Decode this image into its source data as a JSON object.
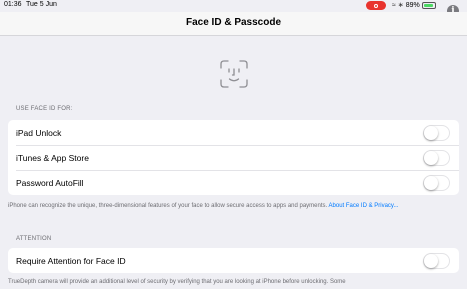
{
  "status_bar": {
    "time": "01:36",
    "date": "Tue 5 Jun",
    "wifi_icon": "wifi-icon",
    "bluetooth_icon": "bluetooth-icon",
    "battery_percent": "89%",
    "battery_level": 0.89,
    "recording_color": "#e8332e"
  },
  "nav": {
    "title": "Face ID & Passcode"
  },
  "header_icon": "face-id-icon",
  "use_face_id": {
    "header": "USE FACE ID FOR:",
    "rows": [
      {
        "label": "iPad Unlock",
        "on": false
      },
      {
        "label": "iTunes & App Store",
        "on": false
      },
      {
        "label": "Password AutoFill",
        "on": false
      }
    ],
    "footer": "iPhone can recognize the unique, three-dimensional features of your face to allow secure access to apps and payments.",
    "footer_link": "About Face ID & Privacy..."
  },
  "attention": {
    "header": "ATTENTION",
    "rows": [
      {
        "label": "Require Attention for Face ID",
        "on": false
      }
    ],
    "footer": "TrueDepth camera will provide an additional level of security by verifying that you are looking at iPhone before unlocking. Some"
  },
  "colors": {
    "background": "#efeff4",
    "link": "#007aff",
    "toggle_off_border": "#e3e3e6"
  }
}
